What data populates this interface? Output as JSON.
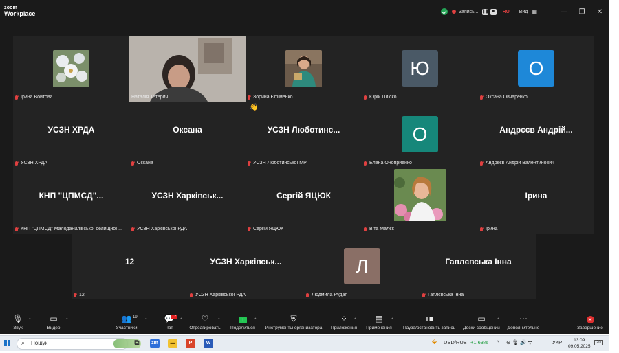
{
  "app": {
    "logo_line1": "zoom",
    "logo_line2": "Workplace",
    "recording_label": "Запись...",
    "lang": "RU",
    "view_label": "Вид",
    "view_icon": "grid-icon"
  },
  "participants": [
    {
      "display": "",
      "label": "Ірина Войтова",
      "muted": true,
      "kind": "photo-flowers"
    },
    {
      "display": "",
      "label": "Наталія Тетерич",
      "muted": false,
      "kind": "video",
      "active": true
    },
    {
      "display": "",
      "label": "Зорина  Єфіменко",
      "muted": true,
      "kind": "photo-woman-dark"
    },
    {
      "display": "",
      "label": "Юрій Пліско",
      "muted": true,
      "kind": "avatar",
      "initial": "Ю",
      "color": "#4a5966"
    },
    {
      "display": "",
      "label": "Оксана Овчаренко",
      "muted": true,
      "kind": "avatar",
      "initial": "О",
      "color": "#1e88d8"
    },
    {
      "display": "УСЗН ХРДА",
      "label": "УСЗН ХРДА",
      "muted": true,
      "kind": "name"
    },
    {
      "display": "Оксана",
      "label": "Оксана",
      "muted": true,
      "kind": "name"
    },
    {
      "display": "УСЗН  Люботинс...",
      "label": "УСЗН Люботинської МР",
      "muted": true,
      "kind": "name"
    },
    {
      "display": "",
      "label": "Елена Оноприенко",
      "muted": true,
      "kind": "avatar",
      "initial": "О",
      "color": "#16877a"
    },
    {
      "display": "Андрєєв Андрій...",
      "label": "Андрєєв Андрій Валентинович",
      "muted": true,
      "kind": "name"
    },
    {
      "display": "КНП  \"ЦПМСД\"...",
      "label": "КНП \"ЦПМСД\" Малоданилівської селищної ...",
      "muted": true,
      "kind": "name"
    },
    {
      "display": "УСЗН  Харківськ...",
      "label": "УСЗН Харківської РДА",
      "muted": true,
      "kind": "name"
    },
    {
      "display": "Сергій ЯЦЮК",
      "label": "Сергій ЯЦЮК",
      "muted": true,
      "kind": "name"
    },
    {
      "display": "",
      "label": "Віта Малєк",
      "muted": true,
      "kind": "photo-woman-flowers"
    },
    {
      "display": "Ірина",
      "label": "Ірина",
      "muted": true,
      "kind": "name"
    }
  ],
  "participants_row2": [
    {
      "display": "12",
      "label": "12",
      "muted": true,
      "kind": "name"
    },
    {
      "display": "УСЗН  Харківськ...",
      "label": "УСЗН Харківської РДА",
      "muted": true,
      "kind": "name"
    },
    {
      "display": "",
      "label": "Людмила Рудая",
      "muted": true,
      "kind": "avatar",
      "initial": "Л",
      "color": "#8a6f66"
    },
    {
      "display": "Гаплєвська Інна",
      "label": "Гаплєвська Інна",
      "muted": true,
      "kind": "name"
    }
  ],
  "toolbar": {
    "audio": "Звук",
    "video": "Видео",
    "participants": "Участники",
    "participants_count": "19",
    "chat": "Чат",
    "chat_badge": "12",
    "react": "Отреагировать",
    "share": "Поделиться",
    "host_tools": "Инструменты организатора",
    "apps": "Приложения",
    "notes": "Примечания",
    "pause_rec": "Пауза/остановить запись",
    "whiteboards": "Доски сообщений",
    "more": "Дополнительно",
    "end": "Завершение"
  },
  "taskbar": {
    "search": "Пошук",
    "ticker": "USD/RUB",
    "ticker_change": "+1.63%",
    "lang": "УКР",
    "time": "13:09",
    "date": "09.05.2025",
    "notif_count": "20"
  },
  "colors": {
    "active_border": "#23d160",
    "muted_red": "#e04040",
    "share_green": "#23c553",
    "end_red": "#e03030"
  }
}
